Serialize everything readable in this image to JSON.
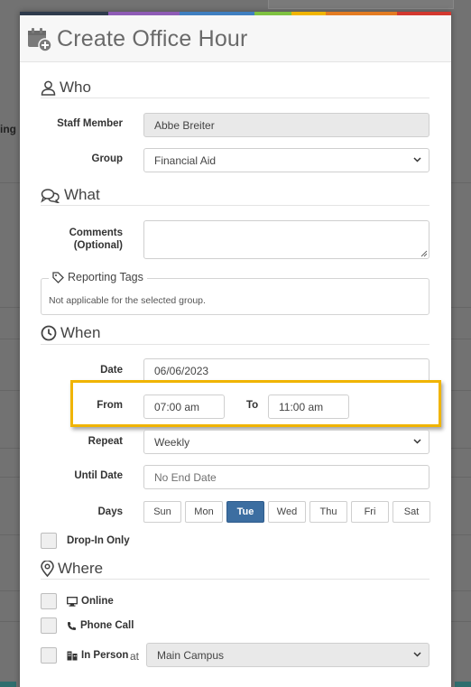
{
  "background": {
    "partial_label": "ing"
  },
  "modal": {
    "title": "Create Office Hour",
    "stripe_colors": [
      "#2f3b4c",
      "#8e5bb5",
      "#3f7fc0",
      "#7fc241",
      "#f0b400",
      "#e37b22",
      "#d2382f"
    ]
  },
  "who": {
    "title": "Who",
    "staff_label": "Staff Member",
    "staff_value": "Abbe Breiter",
    "group_label": "Group",
    "group_value": "Financial Aid"
  },
  "what": {
    "title": "What",
    "comments_label_line1": "Comments",
    "comments_label_line2": "(Optional)",
    "comments_value": "",
    "tags_legend": "Reporting Tags",
    "tags_text": "Not applicable for the selected group."
  },
  "when": {
    "title": "When",
    "date_label": "Date",
    "date_value": "06/06/2023",
    "from_label": "From",
    "from_value": "07:00 am",
    "to_label": "To",
    "to_value": "11:00 am",
    "repeat_label": "Repeat",
    "repeat_value": "Weekly",
    "until_label": "Until Date",
    "until_placeholder": "No End Date",
    "days_label": "Days",
    "days": [
      "Sun",
      "Mon",
      "Tue",
      "Wed",
      "Thu",
      "Fri",
      "Sat"
    ],
    "selected_day": "Tue",
    "dropin_label": "Drop-In Only"
  },
  "where": {
    "title": "Where",
    "online_label": "Online",
    "phone_label": "Phone Call",
    "inperson_label": "In Person",
    "at_text": "at",
    "campus_value": "Main Campus"
  },
  "colors": {
    "highlight": "#f0b400",
    "selected_day": "#3c6ea1"
  }
}
